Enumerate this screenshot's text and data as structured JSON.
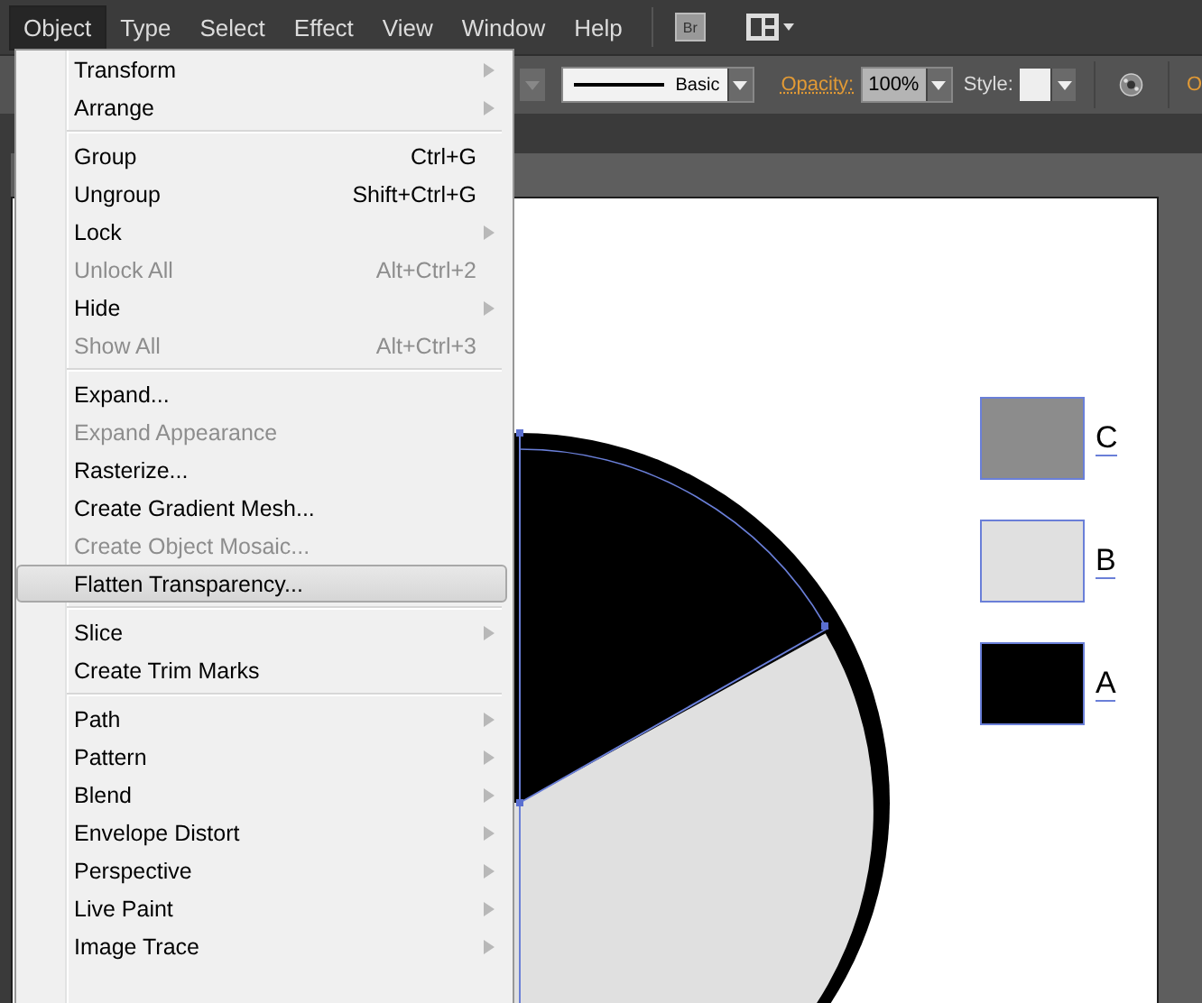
{
  "menu_bar": [
    {
      "label": "Object",
      "selected": true
    },
    {
      "label": "Type",
      "selected": false
    },
    {
      "label": "Select",
      "selected": false
    },
    {
      "label": "Effect",
      "selected": false
    },
    {
      "label": "View",
      "selected": false
    },
    {
      "label": "Window",
      "selected": false
    },
    {
      "label": "Help",
      "selected": false
    }
  ],
  "bridge_button": {
    "label": "Br"
  },
  "control_bar": {
    "stroke_style": "Basic",
    "opacity_label": "Opacity:",
    "opacity_value": "100%",
    "style_label": "Style:",
    "cut_label": "O"
  },
  "object_menu": [
    [
      {
        "label": "Transform",
        "submenu": true,
        "disabled": false,
        "selected": false
      },
      {
        "label": "Arrange",
        "submenu": true,
        "disabled": false,
        "selected": false
      }
    ],
    [
      {
        "label": "Group",
        "shortcut": "Ctrl+G",
        "submenu": false,
        "disabled": false,
        "selected": false
      },
      {
        "label": "Ungroup",
        "shortcut": "Shift+Ctrl+G",
        "submenu": false,
        "disabled": false,
        "selected": false
      },
      {
        "label": "Lock",
        "submenu": true,
        "disabled": false,
        "selected": false
      },
      {
        "label": "Unlock All",
        "shortcut": "Alt+Ctrl+2",
        "submenu": false,
        "disabled": true,
        "selected": false
      },
      {
        "label": "Hide",
        "submenu": true,
        "disabled": false,
        "selected": false
      },
      {
        "label": "Show All",
        "shortcut": "Alt+Ctrl+3",
        "submenu": false,
        "disabled": true,
        "selected": false
      }
    ],
    [
      {
        "label": "Expand...",
        "submenu": false,
        "disabled": false,
        "selected": false
      },
      {
        "label": "Expand Appearance",
        "submenu": false,
        "disabled": true,
        "selected": false
      },
      {
        "label": "Rasterize...",
        "submenu": false,
        "disabled": false,
        "selected": false
      },
      {
        "label": "Create Gradient Mesh...",
        "submenu": false,
        "disabled": false,
        "selected": false
      },
      {
        "label": "Create Object Mosaic...",
        "submenu": false,
        "disabled": true,
        "selected": false
      },
      {
        "label": "Flatten Transparency...",
        "submenu": false,
        "disabled": false,
        "selected": true
      }
    ],
    [
      {
        "label": "Slice",
        "submenu": true,
        "disabled": false,
        "selected": false
      },
      {
        "label": "Create Trim Marks",
        "submenu": false,
        "disabled": false,
        "selected": false
      }
    ],
    [
      {
        "label": "Path",
        "submenu": true,
        "disabled": false,
        "selected": false
      },
      {
        "label": "Pattern",
        "submenu": true,
        "disabled": false,
        "selected": false
      },
      {
        "label": "Blend",
        "submenu": true,
        "disabled": false,
        "selected": false
      },
      {
        "label": "Envelope Distort",
        "submenu": true,
        "disabled": false,
        "selected": false
      },
      {
        "label": "Perspective",
        "submenu": true,
        "disabled": false,
        "selected": false
      },
      {
        "label": "Live Paint",
        "submenu": true,
        "disabled": false,
        "selected": false
      },
      {
        "label": "Image Trace",
        "submenu": true,
        "disabled": false,
        "selected": false
      }
    ]
  ],
  "legend": [
    {
      "label": "C",
      "color": "#8c8c8c"
    },
    {
      "label": "B",
      "color": "#e0e0e0"
    },
    {
      "label": "A",
      "color": "#000000"
    }
  ]
}
